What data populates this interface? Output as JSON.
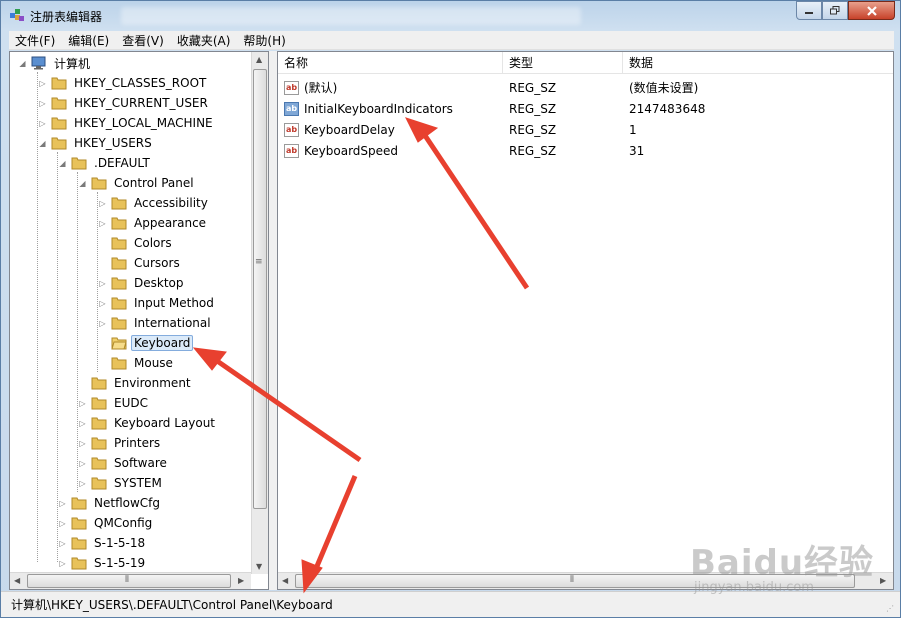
{
  "window": {
    "title": "注册表编辑器"
  },
  "menu": [
    "文件(F)",
    "编辑(E)",
    "查看(V)",
    "收藏夹(A)",
    "帮助(H)"
  ],
  "tree": {
    "root": "计算机",
    "hives": [
      "HKEY_CLASSES_ROOT",
      "HKEY_CURRENT_USER",
      "HKEY_LOCAL_MACHINE",
      "HKEY_USERS"
    ],
    "default_key": ".DEFAULT",
    "control_panel": "Control Panel",
    "control_panel_children": [
      "Accessibility",
      "Appearance",
      "Colors",
      "Cursors",
      "Desktop",
      "Input Method",
      "International",
      "Keyboard",
      "Mouse"
    ],
    "selected": "Keyboard",
    "default_siblings": [
      "Environment",
      "EUDC",
      "Keyboard Layout",
      "Printers",
      "Software",
      "SYSTEM"
    ],
    "users_children": [
      "NetflowCfg",
      "QMConfig",
      "S-1-5-18",
      "S-1-5-19"
    ]
  },
  "list": {
    "columns": [
      "名称",
      "类型",
      "数据"
    ],
    "rows": [
      {
        "name": "(默认)",
        "type": "REG_SZ",
        "data": "(数值未设置)"
      },
      {
        "name": "InitialKeyboardIndicators",
        "type": "REG_SZ",
        "data": "2147483648"
      },
      {
        "name": "KeyboardDelay",
        "type": "REG_SZ",
        "data": "1"
      },
      {
        "name": "KeyboardSpeed",
        "type": "REG_SZ",
        "data": "31"
      }
    ]
  },
  "status": {
    "path": "计算机\\HKEY_USERS\\.DEFAULT\\Control Panel\\Keyboard"
  },
  "watermark": {
    "main": "Baidu经验",
    "sub": "jingyan.baidu.com"
  },
  "colors": {
    "annotation_arrow": "#e8402f",
    "selection": "#dbeaf9",
    "folder": "#e8c25a"
  },
  "icons": {
    "app": "registry-editor-icon",
    "computer": "computer-icon",
    "folder": "folder-icon",
    "value": "string-value-icon"
  }
}
